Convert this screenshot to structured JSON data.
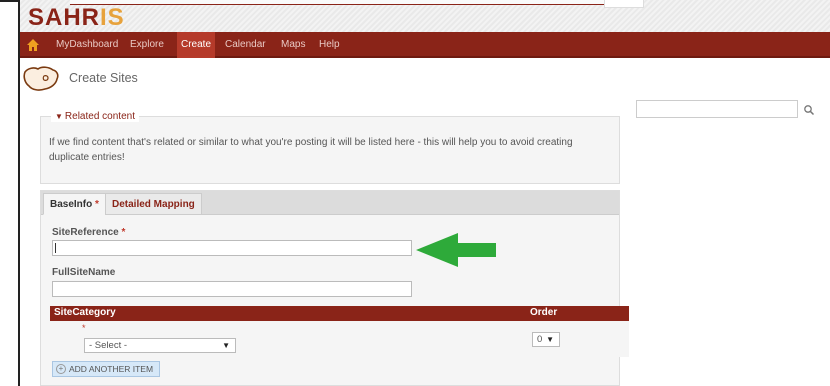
{
  "logo": {
    "part1": "SAHR",
    "part2": "IS"
  },
  "nav": {
    "home_icon": "home-icon",
    "items": [
      "MyDashboard",
      "Explore",
      "Create",
      "Calendar",
      "Maps",
      "Help"
    ],
    "active": "Create"
  },
  "page": {
    "title": "Create Sites",
    "title_icon": "south-africa-map-icon"
  },
  "search": {
    "placeholder": "",
    "button_icon": "search-icon"
  },
  "related": {
    "legend": "Related content",
    "text": "If we find content that's related or similar to what you're posting it will be listed here - this will help you to avoid creating duplicate entries!"
  },
  "tabs": {
    "base": "BaseInfo",
    "base_required": "*",
    "mapping": "Detailed Mapping"
  },
  "form": {
    "site_reference_label": "SiteReference",
    "site_reference_required": "*",
    "site_reference_value": "",
    "full_site_name_label": "FullSiteName",
    "full_site_name_value": ""
  },
  "category_table": {
    "col_category": "SiteCategory",
    "col_order": "Order",
    "required": "*",
    "select_value": "- Select -",
    "order_value": "0",
    "add_button": "ADD ANOTHER ITEM"
  },
  "colors": {
    "brand": "#8a2418",
    "logo_accent": "#e7a23c",
    "arrow": "#2eaa3a"
  },
  "annotation": {
    "arrow_icon": "green-arrow-icon"
  }
}
